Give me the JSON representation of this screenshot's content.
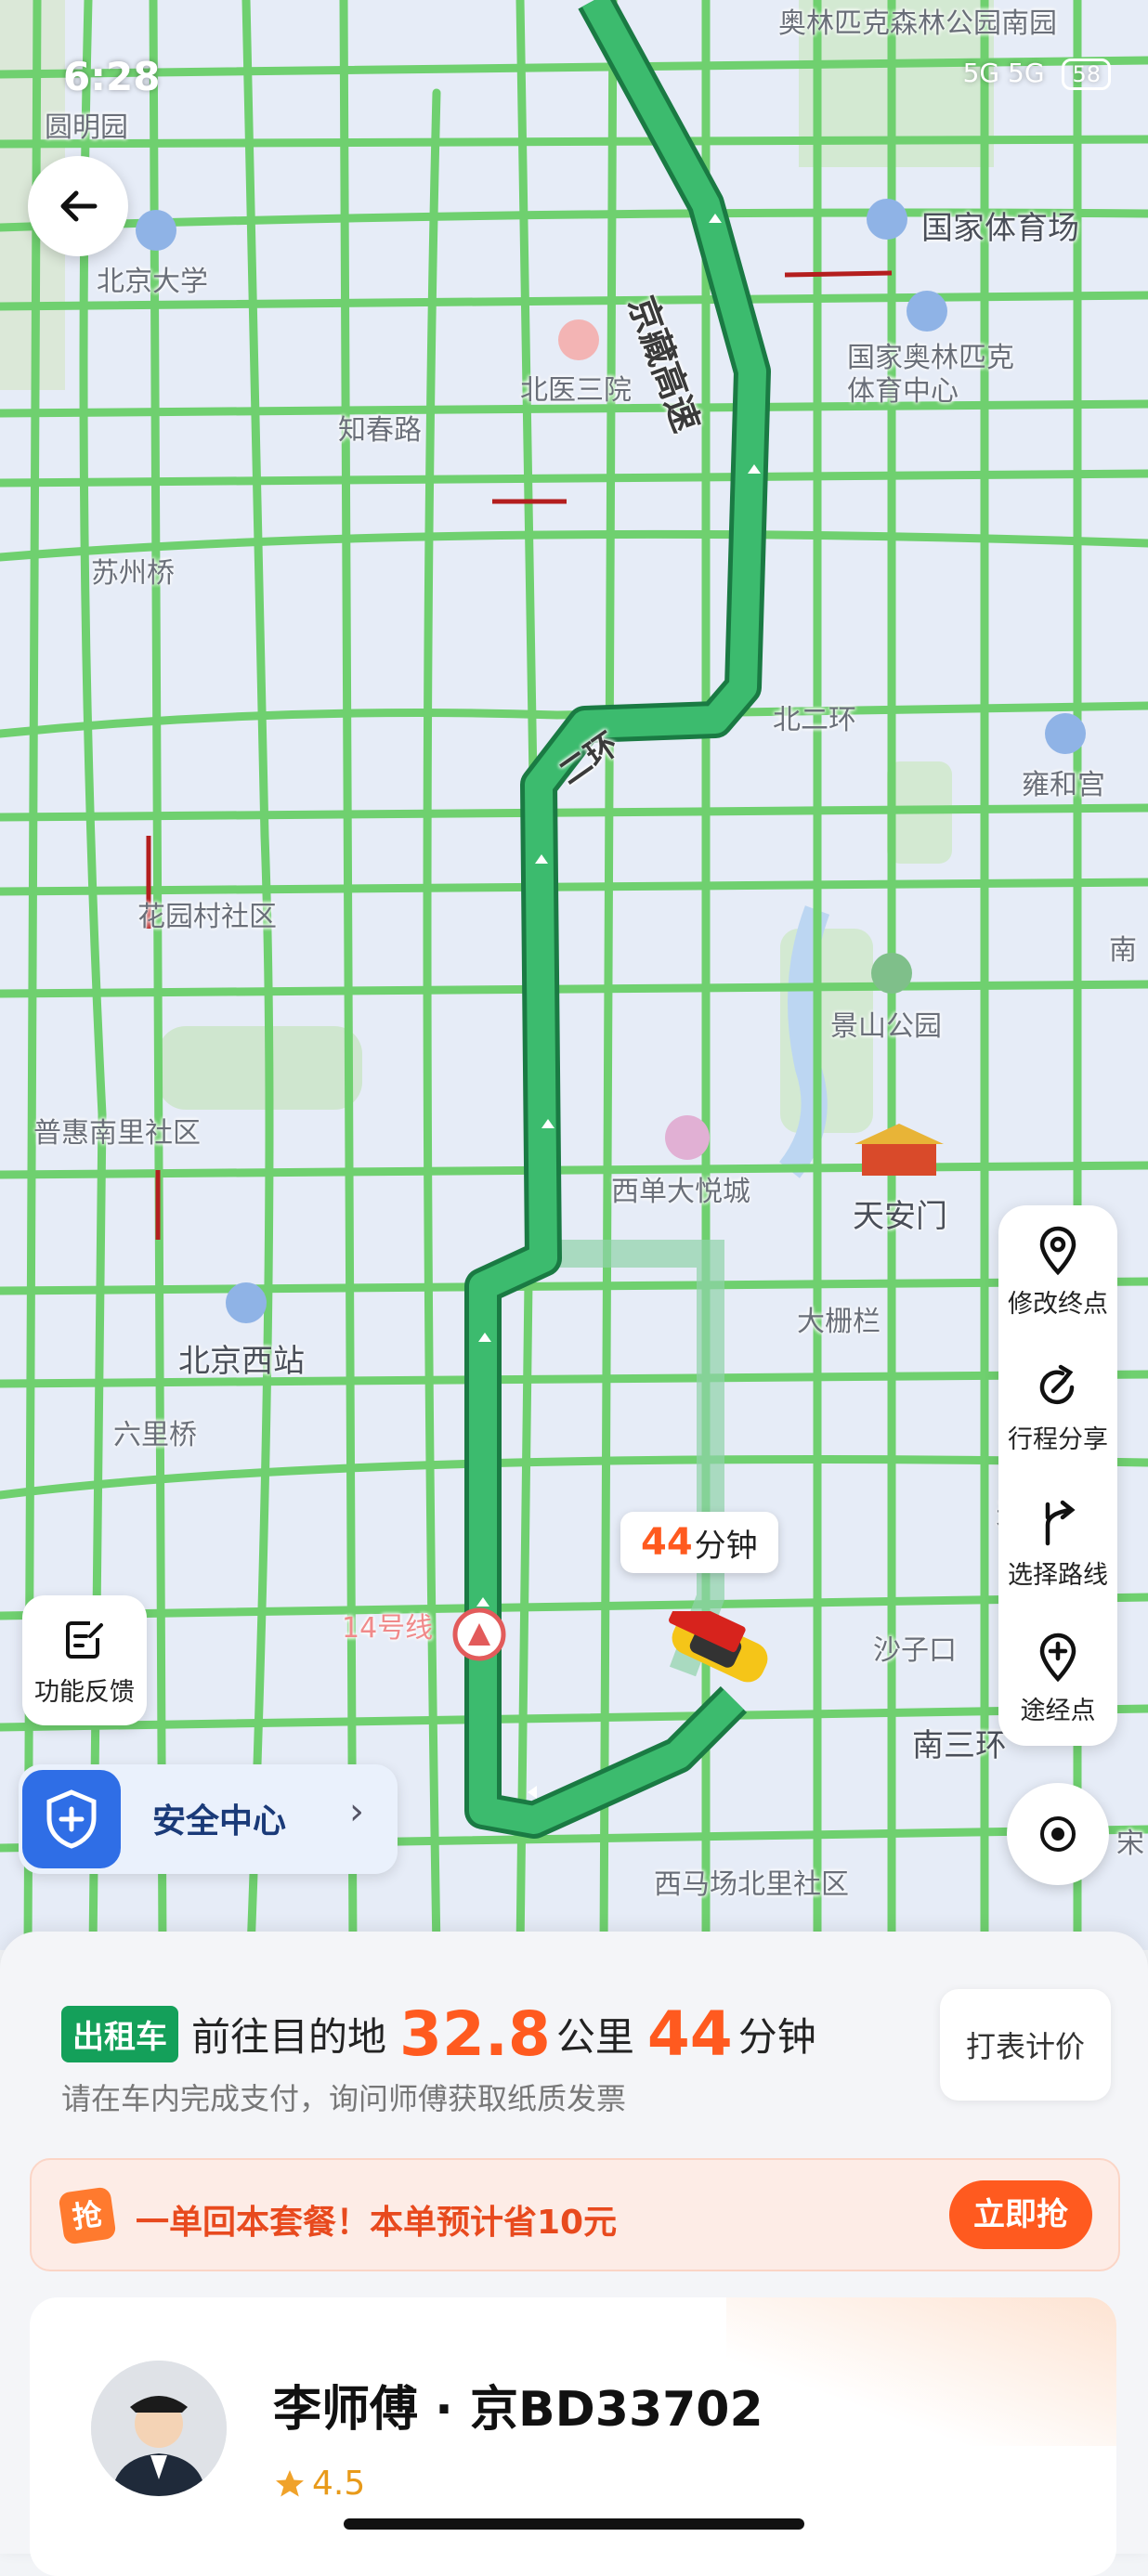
{
  "status_bar": {
    "time": "6:28",
    "network": "5G 5G",
    "battery": "58"
  },
  "map": {
    "labels": {
      "olympic_park_south": "奥林匹克森林公园南园",
      "yuanmingyuan": "圆明园",
      "peking_university": "北京大学",
      "national_stadium": "国家体育场",
      "beiyi_third_hospital": "北医三院",
      "olympic_sports_center": "国家奥林匹克体育中心",
      "zhichun_road": "知春路",
      "suzhou_bridge": "苏州桥",
      "north_second_ring": "北二环",
      "yonghegong": "雍和宫",
      "huayuancun": "花园村社区",
      "jingshan_park": "景山公园",
      "puhui_nanli": "普惠南里社区",
      "xidan_joy_city": "西单大悦城",
      "tiananmen": "天安门",
      "dashilan": "大栅栏",
      "beijing_west_station": "北京西站",
      "liulihe_bridge": "六里桥",
      "line14": "14号线",
      "shaziko": "沙子口",
      "south_third_ring": "南三环",
      "ximachang": "西马场北里社区",
      "second_ring": "二环",
      "jingzang_expressway": "京藏高速",
      "tiantan": "天坛",
      "nan": "南",
      "song": "宋"
    }
  },
  "eta_bubble": {
    "number": "44",
    "unit": "分钟"
  },
  "toolbar": {
    "items": [
      {
        "label": "修改终点",
        "icon": "location-pin-icon"
      },
      {
        "label": "行程分享",
        "icon": "share-icon"
      },
      {
        "label": "选择路线",
        "icon": "route-fork-icon"
      },
      {
        "label": "途经点",
        "icon": "add-waypoint-icon"
      }
    ]
  },
  "feedback": {
    "label": "功能反馈"
  },
  "safety": {
    "label": "安全中心",
    "chevron": "›"
  },
  "trip": {
    "tag": "出租车",
    "prefix": "前往目的地",
    "distance": "32.8",
    "distance_unit": "公里",
    "minutes": "44",
    "minutes_unit": "分钟",
    "subtitle": "请在车内完成支付，询问师傅获取纸质发票",
    "meter_button": "打表计价"
  },
  "promo": {
    "badge": "抢",
    "text": "一单回本套餐！本单预计省10元",
    "button": "立即抢"
  },
  "driver": {
    "name": "李师傅 · 京BD33702",
    "rating": "4.5"
  },
  "colors": {
    "route": "#27a55c",
    "accent": "#ff5a1f",
    "taxi_tag": "#14a05a",
    "safety_blue": "#2f6ee6"
  }
}
